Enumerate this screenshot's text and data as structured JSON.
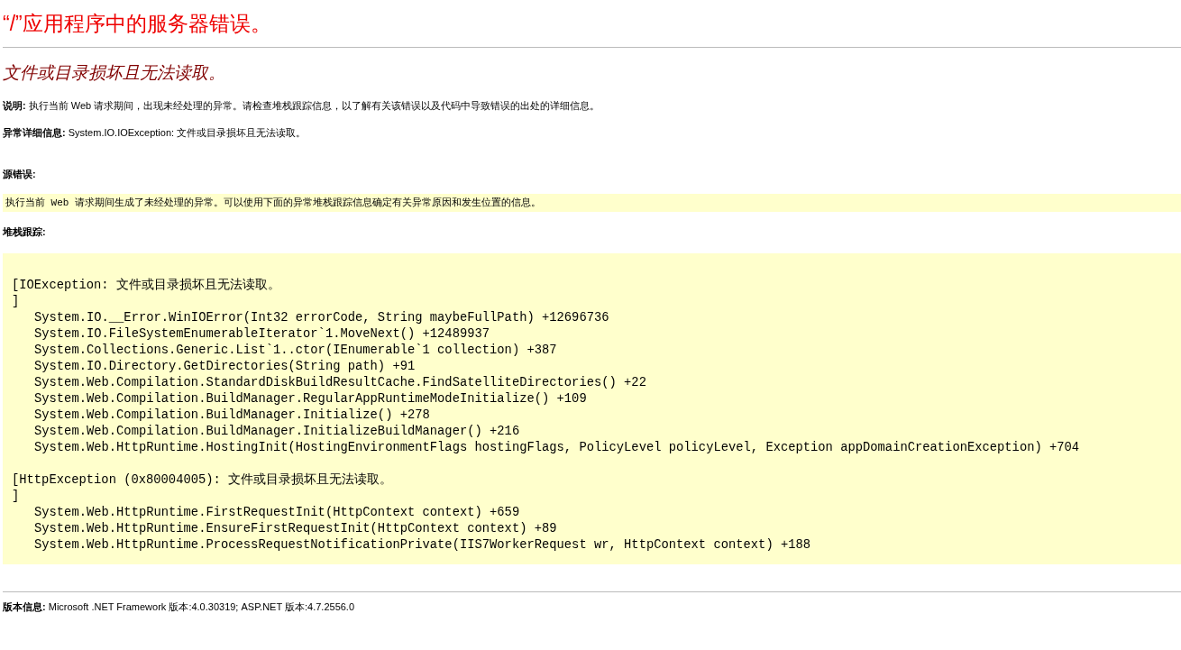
{
  "title": "“/”应用程序中的服务器错误。",
  "subtitle": "文件或目录损坏且无法读取。",
  "description": "**说明:** 执行当前 Web 请求期间，出现未经处理的异常。请检查堆栈跟踪信息，以了解有关该错误以及代码中导致错误的出处的详细信息。",
  "exception_details": "**异常详细信息:** System.IO.IOException: 文件或目录损坏且无法读取。",
  "source_error": {
    "heading": "源错误:",
    "message": "执行当前 Web 请求期间生成了未经处理的异常。可以使用下面的异常堆栈跟踪信息确定有关异常原因和发生位置的信息。"
  },
  "stack_trace": {
    "heading": "堆栈跟踪:",
    "blocks": [
      {
        "header": "[IOException: 文件或目录损坏且无法读取。",
        "close": "]",
        "frames": [
          "System.IO.__Error.WinIOError(Int32 errorCode, String maybeFullPath) +12696736",
          "System.IO.FileSystemEnumerableIterator`1.MoveNext() +12489937",
          "System.Collections.Generic.List`1..ctor(IEnumerable`1 collection) +387",
          "System.IO.Directory.GetDirectories(String path) +91",
          "System.Web.Compilation.StandardDiskBuildResultCache.FindSatelliteDirectories() +22",
          "System.Web.Compilation.BuildManager.RegularAppRuntimeModeInitialize() +109",
          "System.Web.Compilation.BuildManager.Initialize() +278",
          "System.Web.Compilation.BuildManager.InitializeBuildManager() +216",
          "System.Web.HttpRuntime.HostingInit(HostingEnvironmentFlags hostingFlags, PolicyLevel policyLevel, Exception appDomainCreationException) +704"
        ]
      },
      {
        "header": "[HttpException (0x80004005): 文件或目录损坏且无法读取。",
        "close": "]",
        "frames": [
          "System.Web.HttpRuntime.FirstRequestInit(HttpContext context) +659",
          "System.Web.HttpRuntime.EnsureFirstRequestInit(HttpContext context) +89",
          "System.Web.HttpRuntime.ProcessRequestNotificationPrivate(IIS7WorkerRequest wr, HttpContext context) +188"
        ]
      }
    ]
  },
  "version_info": "**版本信息:** Microsoft .NET Framework 版本:4.0.30319; ASP.NET 版本:4.7.2556.0"
}
